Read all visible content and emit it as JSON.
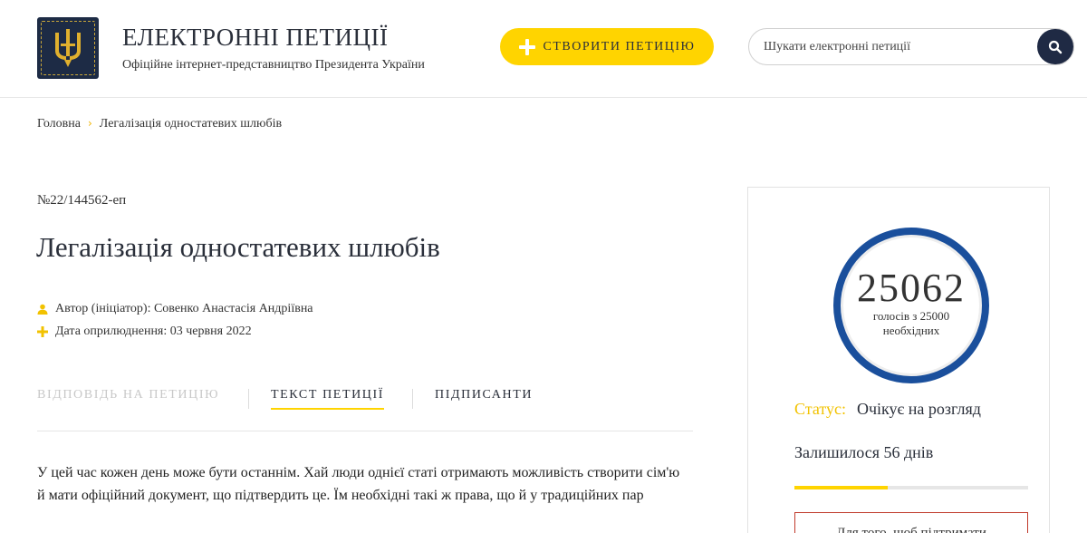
{
  "header": {
    "title": "ЕЛЕКТРОННІ ПЕТИЦІЇ",
    "subtitle": "Офіційне інтернет-представництво Президента України",
    "create_button": "СТВОРИТИ ПЕТИЦІЮ",
    "search_placeholder": "Шукати електронні петиції"
  },
  "breadcrumb": {
    "home": "Головна",
    "separator": "›",
    "current": "Легалізація одностатевих шлюбів"
  },
  "petition": {
    "number": "№22/144562-еп",
    "title": "Легалізація одностатевих шлюбів",
    "author": "Автор (ініціатор): Совенко Анастасія Андріївна",
    "date": "Дата оприлюднення: 03 червня 2022",
    "text": "У цей час кожен день може бути останнім. Хай люди однієї статі отримають можливість створити сім'ю й мати офіційний документ, що підтвердить це. Їм необхідні такі ж права, що й у традиційних пар"
  },
  "tabs": [
    {
      "label": "ВІДПОВІДЬ НА ПЕТИЦІЮ",
      "state": "disabled"
    },
    {
      "label": "ТЕКСТ ПЕТИЦІЇ",
      "state": "active"
    },
    {
      "label": "ПІДПИСАНТИ",
      "state": "normal"
    }
  ],
  "sidebar": {
    "votes": "25062",
    "votes_caption": "голосів з 25000 необхідних",
    "status_label": "Статус:",
    "status_value": "Очікує на розгляд",
    "days_left": "Залишилося 56 днів",
    "progress_fraction": 0.4,
    "support_text": "Для того, щоб підтримати"
  },
  "colors": {
    "accent_yellow": "#ffd400",
    "navy": "#1f2a44",
    "circle_blue": "#1a4f9c",
    "support_border": "#c0392b"
  },
  "icons": {
    "logo": "trident-emblem-icon",
    "create": "plus-icon",
    "search": "search-icon",
    "author": "person-icon",
    "date": "plus-icon"
  }
}
